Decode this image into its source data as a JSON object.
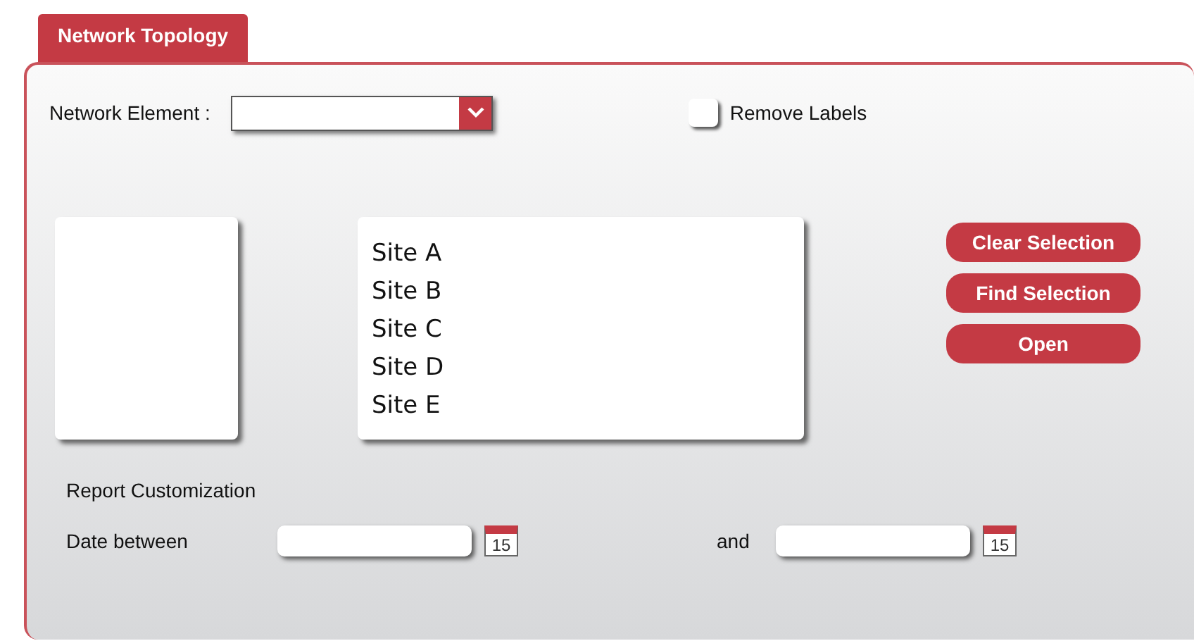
{
  "tabs": [
    {
      "label": "Network Topology",
      "selected": true
    }
  ],
  "network_element": {
    "label": "Network Element :"
  },
  "remove_labels": {
    "label": "Remove Labels",
    "checked": false
  },
  "site_list": [
    "Site A",
    "Site B",
    "Site C",
    "Site D",
    "Site E"
  ],
  "buttons": [
    "Clear Selection",
    "Find Selection",
    "Open"
  ],
  "report": {
    "title": "Report Customization",
    "date_label": "Date between",
    "and_label": "and",
    "calendar_days": [
      "15",
      "15"
    ]
  }
}
